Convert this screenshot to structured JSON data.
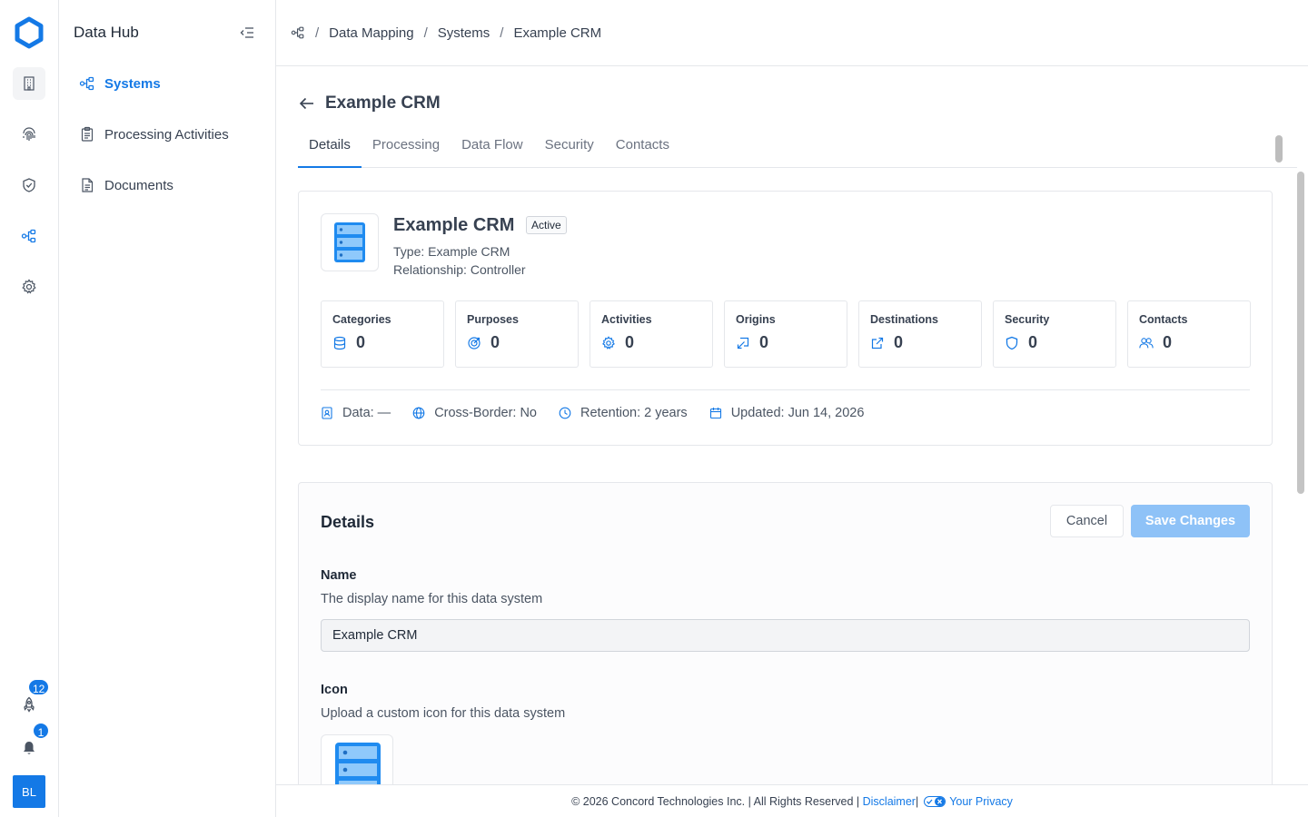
{
  "colors": {
    "accent": "#1479e6",
    "accent_disabled": "#8ec2f7",
    "border": "#e5e7eb"
  },
  "rail": {
    "icons": [
      "building-icon",
      "fingerprint-icon",
      "shield-check-icon",
      "data-map-icon",
      "gear-icon"
    ],
    "launch_badge": "12",
    "notification_badge": "1",
    "avatar_initials": "BL"
  },
  "sidenav": {
    "title": "Data Hub",
    "items": [
      {
        "label": "Systems",
        "icon": "systems-icon",
        "active": true
      },
      {
        "label": "Processing Activities",
        "icon": "clipboard-icon",
        "active": false
      },
      {
        "label": "Documents",
        "icon": "document-icon",
        "active": false
      }
    ]
  },
  "breadcrumb": [
    "Data Mapping",
    "Systems",
    "Example CRM"
  ],
  "page": {
    "title": "Example CRM",
    "tabs": [
      "Details",
      "Processing",
      "Data Flow",
      "Security",
      "Contacts"
    ],
    "active_tab": "Details"
  },
  "system": {
    "name": "Example CRM",
    "status": "Active",
    "type": "Type: Example CRM",
    "relationship": "Relationship: Controller",
    "stats": [
      {
        "label": "Categories",
        "value": "0",
        "icon": "database-icon"
      },
      {
        "label": "Purposes",
        "value": "0",
        "icon": "target-icon"
      },
      {
        "label": "Activities",
        "value": "0",
        "icon": "gear-icon"
      },
      {
        "label": "Origins",
        "value": "0",
        "icon": "origin-icon"
      },
      {
        "label": "Destinations",
        "value": "0",
        "icon": "external-link-icon"
      },
      {
        "label": "Security",
        "value": "0",
        "icon": "shield-icon"
      },
      {
        "label": "Contacts",
        "value": "0",
        "icon": "users-icon"
      }
    ],
    "facts": {
      "data": "Data: —",
      "cross_border": "Cross-Border: No",
      "retention": "Retention: 2 years",
      "updated": "Updated: Jun 14, 2026"
    }
  },
  "details_form": {
    "title": "Details",
    "cancel_label": "Cancel",
    "save_label": "Save Changes",
    "name_label": "Name",
    "name_help": "The display name for this data system",
    "name_value": "Example CRM",
    "icon_label": "Icon",
    "icon_help": "Upload a custom icon for this data system"
  },
  "footer": {
    "copyright": "© 2026 Concord Technologies Inc. | All Rights Reserved |",
    "disclaimer": "Disclaimer",
    "separator": "|",
    "privacy": "Your Privacy"
  }
}
